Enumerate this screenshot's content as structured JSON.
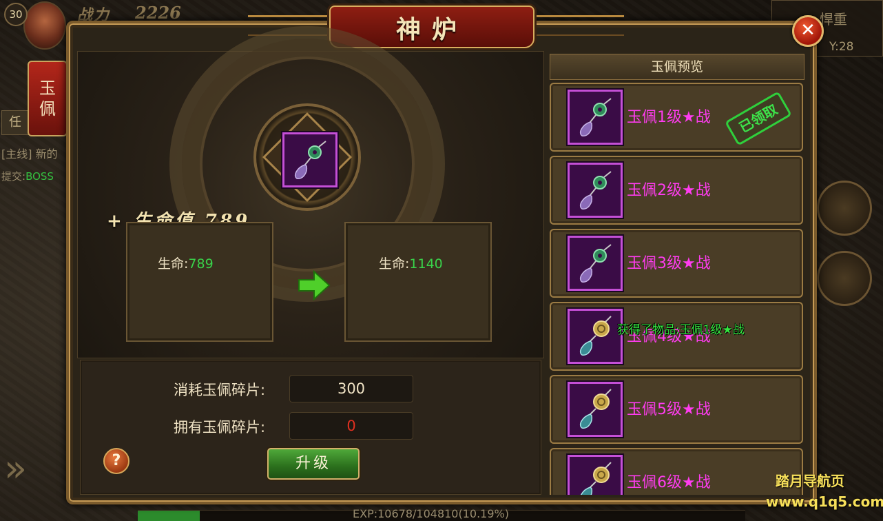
{
  "hud": {
    "level": "30",
    "power_label": "战力",
    "power_value": "2226",
    "side_tab_label_1": "玉",
    "side_tab_label_2": "佩",
    "side_button": "任",
    "quest_line1": "[主线] 新的",
    "quest_line2_prefix": "提交:",
    "quest_line2_boss": "BOSS",
    "map_name": "悍重",
    "map_y": "Y:28",
    "exp_text": "EXP:10678/104810(10.19%)",
    "exp_progress": 0.1019
  },
  "dialog": {
    "title": "神炉",
    "close_icon": "close-x-icon",
    "main_item_icon": "jade-pendant-icon",
    "bonus_text": "+ 生命值 789",
    "current_stat": {
      "label": "生命:",
      "value": "789"
    },
    "next_stat": {
      "label": "生命:",
      "value": "1140"
    },
    "cost_label": "消耗玉佩碎片:",
    "cost_value": "300",
    "own_label": "拥有玉佩碎片:",
    "own_value": "0",
    "help_label": "?",
    "upgrade_label": "升级"
  },
  "preview": {
    "header": "玉佩预览",
    "items": [
      {
        "label": "玉佩1级★战",
        "icon": "jade-pendant-icon",
        "claimed": "已领取"
      },
      {
        "label": "玉佩2级★战",
        "icon": "jade-pendant-icon"
      },
      {
        "label": "玉佩3级★战",
        "icon": "jade-pendant-icon"
      },
      {
        "label": "玉佩4级★战",
        "icon": "gold-pendant-icon"
      },
      {
        "label": "玉佩5级★战",
        "icon": "gold-pendant-icon"
      },
      {
        "label": "玉佩6级★战",
        "icon": "gold-pendant-icon"
      }
    ],
    "toast": "获得了物品:玉佩1级★战"
  },
  "watermark": {
    "line1": "踏月导航页",
    "line2": "www.q1q5.com"
  },
  "colors": {
    "item_name": "#ff3cf0",
    "stat_value": "#39d24a",
    "shortage": "#e03020",
    "toast": "#34e840"
  }
}
